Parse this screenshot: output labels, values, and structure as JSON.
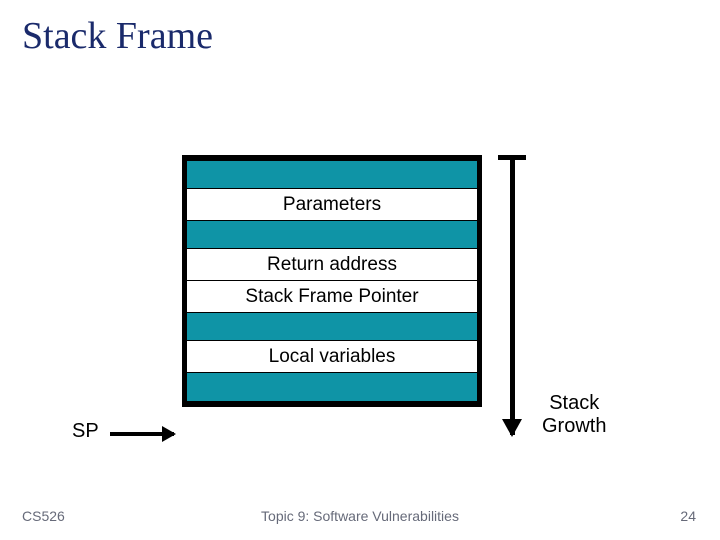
{
  "title": "Stack Frame",
  "rows": {
    "parameters": "Parameters",
    "return_address": "Return address",
    "frame_pointer": "Stack Frame Pointer",
    "locals": "Local variables"
  },
  "sp_label": "SP",
  "growth_label_line1": "Stack",
  "growth_label_line2": "Growth",
  "footer": {
    "course": "CS526",
    "topic": "Topic 9: Software Vulnerabilities",
    "page": "24"
  },
  "colors": {
    "title": "#1a2a6b",
    "fill": "#0f94a6"
  }
}
